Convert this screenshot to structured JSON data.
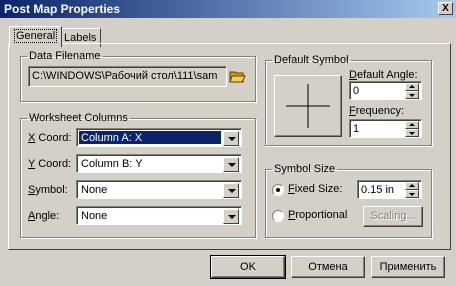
{
  "window": {
    "title": "Post Map Properties",
    "close_glyph": "X"
  },
  "tabs": [
    {
      "label": "General"
    },
    {
      "label": "Labels"
    }
  ],
  "data_filename": {
    "legend": "Data Filename",
    "value": "C:\\WINDOWS\\Рабочий стол\\111\\sam",
    "browse_icon": "folder-open-icon"
  },
  "worksheet_columns": {
    "legend": "Worksheet Columns",
    "rows": [
      {
        "label_ul": "X",
        "label_rest": " Coord:",
        "value": "Column A:  X"
      },
      {
        "label_ul": "Y",
        "label_rest": " Coord:",
        "value": "Column B:  Y"
      },
      {
        "label_ul": "S",
        "label_rest": "ymbol:",
        "value": "None"
      },
      {
        "label_ul": "A",
        "label_rest": "ngle:",
        "value": "None"
      }
    ]
  },
  "default_symbol": {
    "legend": "Default Symbol",
    "angle_label": "Default Angle:",
    "angle_value": "0",
    "frequency_label": "Frequency:",
    "frequency_value": "1"
  },
  "symbol_size": {
    "legend": "Symbol Size",
    "fixed_label": "Fixed Size:",
    "fixed_value": "0.15 in",
    "proportional_label": "Proportional",
    "scaling_label": "Scaling..."
  },
  "buttons": {
    "ok": "OK",
    "cancel": "Отмена",
    "apply": "Применить"
  }
}
